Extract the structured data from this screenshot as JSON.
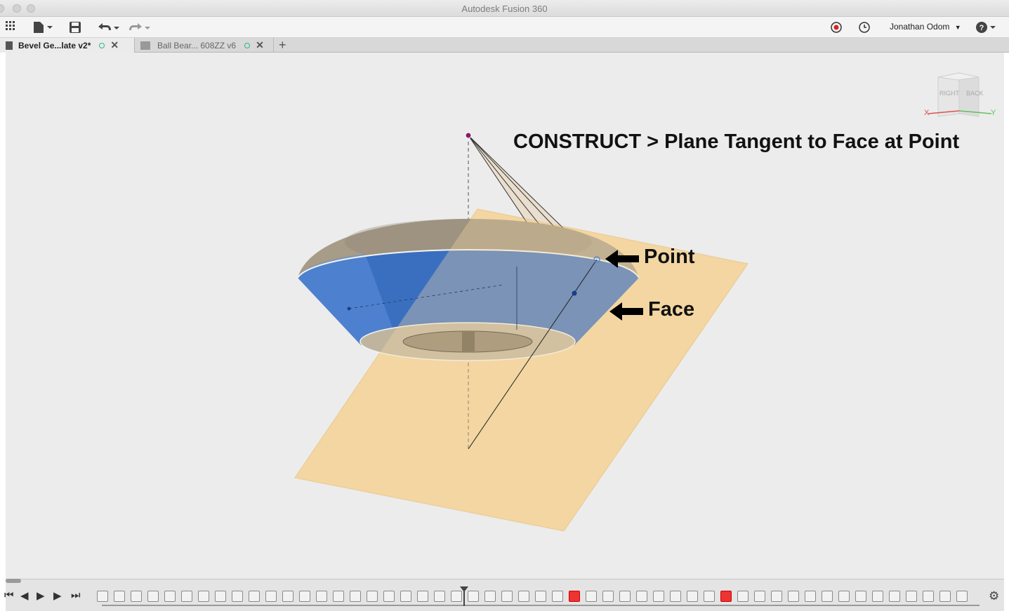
{
  "window": {
    "title": "Autodesk Fusion 360"
  },
  "toolbar": {
    "user_name": "Jonathan Odom",
    "icons": [
      "grid-icon",
      "file-icon",
      "save-icon",
      "undo-icon",
      "redo-icon",
      "record-icon",
      "history-icon",
      "help-icon"
    ]
  },
  "tabs": [
    {
      "label": "Bevel Ge...late v2*",
      "active": true
    },
    {
      "label": "Ball Bear... 608ZZ v6",
      "active": false
    }
  ],
  "canvas": {
    "heading": "CONSTRUCT > Plane Tangent to Face at Point",
    "callout_point": "Point",
    "callout_face": "Face"
  },
  "viewcube": {
    "face_right": "RIGHT",
    "face_back": "BACK",
    "axis_x": "X",
    "axis_y": "Y"
  },
  "timeline": {
    "controls": [
      "skip-start",
      "step-back",
      "play",
      "step-forward",
      "skip-end"
    ],
    "item_count": 52,
    "red_items": [
      28,
      37
    ]
  },
  "colors": {
    "plane": "#f3d6a2",
    "face_blue": "#3a6fc0",
    "metal": "#a79c88",
    "accent_teal": "#2db58e",
    "accent_red": "#e33333"
  }
}
